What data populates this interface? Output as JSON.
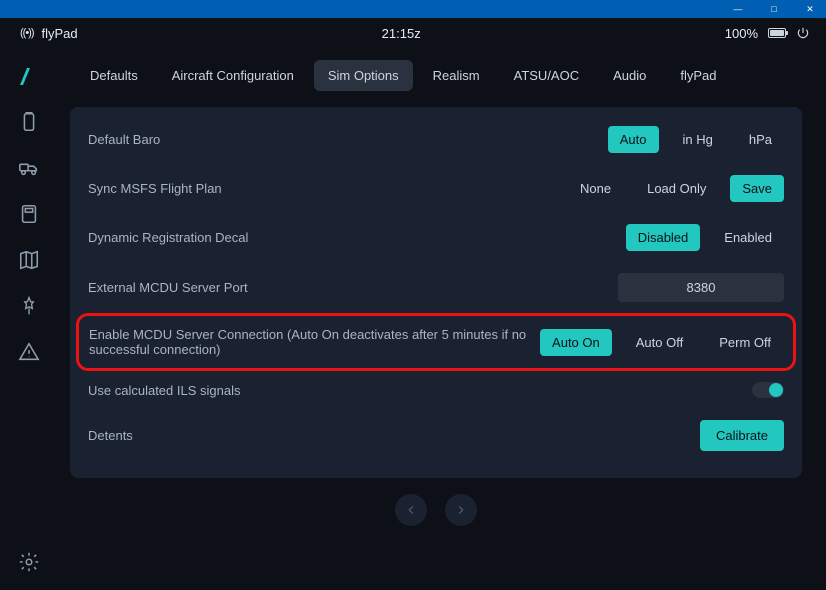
{
  "titlebar": {
    "min": "—",
    "max": "□",
    "close": "✕"
  },
  "topbar": {
    "app_name": "flyPad",
    "time": "21:15z",
    "battery_pct": "100%"
  },
  "tabs": [
    {
      "label": "Defaults",
      "active": false
    },
    {
      "label": "Aircraft Configuration",
      "active": false
    },
    {
      "label": "Sim Options",
      "active": true
    },
    {
      "label": "Realism",
      "active": false
    },
    {
      "label": "ATSU/AOC",
      "active": false
    },
    {
      "label": "Audio",
      "active": false
    },
    {
      "label": "flyPad",
      "active": false
    }
  ],
  "rows": {
    "baro": {
      "label": "Default Baro",
      "options": [
        "Auto",
        "in Hg",
        "hPa"
      ],
      "selected": "Auto"
    },
    "sync": {
      "label": "Sync MSFS Flight Plan",
      "options": [
        "None",
        "Load Only",
        "Save"
      ],
      "selected": "Save"
    },
    "decal": {
      "label": "Dynamic Registration Decal",
      "options": [
        "Disabled",
        "Enabled"
      ],
      "selected": "Disabled"
    },
    "port": {
      "label": "External MCDU Server Port",
      "value": "8380"
    },
    "mcdu_conn": {
      "label": "Enable MCDU Server Connection (Auto On deactivates after 5 minutes if no successful connection)",
      "options": [
        "Auto On",
        "Auto Off",
        "Perm Off"
      ],
      "selected": "Auto On"
    },
    "ils": {
      "label": "Use calculated ILS signals",
      "on": true
    },
    "detents": {
      "label": "Detents",
      "button": "Calibrate"
    }
  },
  "colors": {
    "accent": "#22c7c0",
    "highlight": "#e91313"
  }
}
